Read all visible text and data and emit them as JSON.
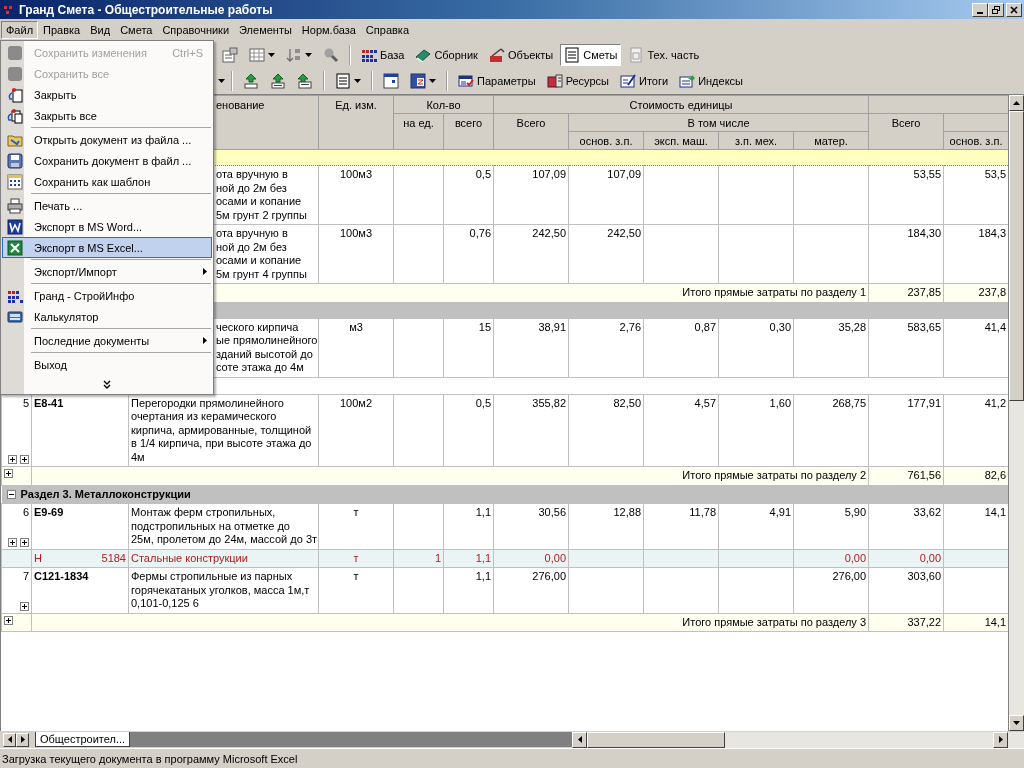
{
  "window": {
    "title": "Гранд Смета - Общестроительные работы"
  },
  "menubar": [
    {
      "label": "Файл",
      "selected": true
    },
    {
      "label": "Правка",
      "selected": false
    },
    {
      "label": "Вид",
      "selected": false
    },
    {
      "label": "Смета",
      "selected": false
    },
    {
      "label": "Справочники",
      "selected": false
    },
    {
      "label": "Элементы",
      "selected": false
    },
    {
      "label": "Норм.база",
      "selected": false
    },
    {
      "label": "Справка",
      "selected": false
    }
  ],
  "toolbar_top": [
    {
      "label": "База",
      "selected": false
    },
    {
      "label": "Сборник",
      "selected": false
    },
    {
      "label": "Объекты",
      "selected": false
    },
    {
      "label": "Сметы",
      "selected": true
    },
    {
      "label": "Тех. часть",
      "selected": false
    }
  ],
  "toolbar_bottom": [
    {
      "label": "Параметры"
    },
    {
      "label": "Ресурсы"
    },
    {
      "label": "Итоги"
    },
    {
      "label": "Индексы"
    }
  ],
  "file_menu": [
    {
      "kind": "item",
      "label": "Сохранить изменения",
      "shortcut": "Ctrl+S",
      "disabled": true,
      "selected": false
    },
    {
      "kind": "item",
      "label": "Сохранить все",
      "disabled": true,
      "selected": false
    },
    {
      "kind": "item",
      "label": "Закрыть",
      "disabled": false,
      "selected": false
    },
    {
      "kind": "item",
      "label": "Закрыть все",
      "disabled": false,
      "selected": false
    },
    {
      "kind": "separator"
    },
    {
      "kind": "item",
      "label": "Открыть документ из файла ...",
      "disabled": false,
      "selected": false
    },
    {
      "kind": "item",
      "label": "Сохранить документ в файл ...",
      "disabled": false,
      "selected": false
    },
    {
      "kind": "item",
      "label": "Сохранить как шаблон",
      "disabled": false,
      "selected": false
    },
    {
      "kind": "separator"
    },
    {
      "kind": "item",
      "label": "Печать ...",
      "disabled": false,
      "selected": false
    },
    {
      "kind": "item",
      "label": "Экспорт в MS Word...",
      "disabled": false,
      "selected": false
    },
    {
      "kind": "item",
      "label": "Экспорт в MS Excel...",
      "disabled": false,
      "selected": true
    },
    {
      "kind": "separator"
    },
    {
      "kind": "item",
      "label": "Экспорт/Импорт",
      "submenu": true,
      "disabled": false,
      "selected": false
    },
    {
      "kind": "separator"
    },
    {
      "kind": "item",
      "label": "Гранд - СтройИнфо",
      "disabled": false,
      "selected": false
    },
    {
      "kind": "item",
      "label": "Калькулятор",
      "disabled": false,
      "selected": false
    },
    {
      "kind": "separator"
    },
    {
      "kind": "item",
      "label": "Последние документы",
      "submenu": true,
      "disabled": false,
      "selected": false
    },
    {
      "kind": "separator"
    },
    {
      "kind": "item",
      "label": "Выход",
      "disabled": false,
      "selected": false
    }
  ],
  "table": {
    "header": {
      "name_fragment": "енование",
      "unit": "Ед. изм.",
      "qty": "Кол-во",
      "per": "на ед.",
      "qty_total": "всего",
      "unit_cost": "Стоимость единицы",
      "cost": "Всего",
      "included": "В том числе",
      "base": "основ. з.п.",
      "mach": "эксп. маш.",
      "mech": "з.п. мех.",
      "mat": "матер.",
      "total": "Всего",
      "tbase": "основ. з.п."
    },
    "rows": [
      {
        "kind": "section",
        "selected": true
      },
      {
        "kind": "item",
        "name_fragment": [
          "ота вручную в",
          "ной до 2м без",
          "осами и копание",
          "5м грунт 2 группы"
        ],
        "unit": "100м3",
        "qty": "0,5",
        "cost": "107,09",
        "base": "107,09",
        "total": "53,55",
        "tbase": "53,5"
      },
      {
        "kind": "item",
        "name_fragment": [
          "ота вручную в",
          "ной до 2м без",
          "осами и копание",
          "5м грунт 4 группы"
        ],
        "unit": "100м3",
        "qty": "0,76",
        "cost": "242,50",
        "base": "242,50",
        "total": "184,30",
        "tbase": "184,3"
      },
      {
        "kind": "subtotal",
        "label": "Итого прямые затраты по разделу 1",
        "total": "237,85",
        "tbase": "237,8"
      },
      {
        "kind": "section",
        "selected": false
      },
      {
        "kind": "item",
        "name_fragment": [
          "ческого кирпича",
          "ые прямолинейного",
          "зданий высотой до",
          "соте этажа до 4м"
        ],
        "unit": "м3",
        "qty": "15",
        "cost": "38,91",
        "base": "2,76",
        "mach": "0,87",
        "mech": "0,30",
        "mat": "35,28",
        "total": "583,65",
        "tbase": "41,4"
      },
      {
        "kind": "blank"
      },
      {
        "kind": "item",
        "number": "5",
        "code": "Е8-41",
        "name": [
          "Перегородки прямолинейного",
          "очертания из керамического",
          "кирпича, армированные, толщиной",
          "в 1/4 кирпича, при высоте этажа до",
          "4м"
        ],
        "unit": "100м2",
        "qty": "0,5",
        "cost": "355,82",
        "base": "82,50",
        "mach": "4,57",
        "mech": "1,60",
        "mat": "268,75",
        "total": "177,91",
        "tbase": "41,2",
        "expand_resources": true,
        "expand_works": true
      },
      {
        "kind": "subtotal",
        "expandable": true,
        "label": "Итого прямые затраты по разделу 2",
        "total": "761,56",
        "tbase": "82,6"
      },
      {
        "kind": "section",
        "selected": false,
        "expanded": true,
        "title": "Раздел 3. Металлоконструкции"
      },
      {
        "kind": "item",
        "number": "6",
        "code": "Е9-69",
        "name": [
          "Монтаж ферм стропильных,",
          "подстропильных на отметке до",
          "25м, пролетом до 24м, массой до 3т"
        ],
        "unit": "т",
        "qty": "1,1",
        "cost": "30,56",
        "base": "12,88",
        "mach": "11,78",
        "mech": "4,91",
        "mat": "5,90",
        "total": "33,62",
        "tbase": "14,1",
        "expand_resources": true,
        "expand_works": true
      },
      {
        "kind": "resource",
        "type": "Н",
        "code": "5184",
        "name": [
          "Стальные конструкции"
        ],
        "unit": "т",
        "per": "1",
        "qty": "1,1",
        "cost": "0,00",
        "mat": "0,00",
        "total": "0,00"
      },
      {
        "kind": "item",
        "number": "7",
        "code": "С121-1834",
        "name": [
          "Фермы стропильные из парных",
          "горячекатаных уголков, масса 1м,т",
          "0,101-0,125 6"
        ],
        "unit": "т",
        "qty": "1,1",
        "cost": "276,00",
        "mat": "276,00",
        "total": "303,60",
        "expand_resources": false,
        "expand_works": true
      },
      {
        "kind": "subtotal",
        "expandable": true,
        "label": "Итого прямые затраты по разделу 3",
        "total": "337,22",
        "tbase": "14,1"
      }
    ]
  },
  "sheet_tabs": [
    {
      "label": "Общестроител...",
      "selected": true
    }
  ],
  "status_bar": "Загрузка текущего документа в программу Microsoft Excel"
}
